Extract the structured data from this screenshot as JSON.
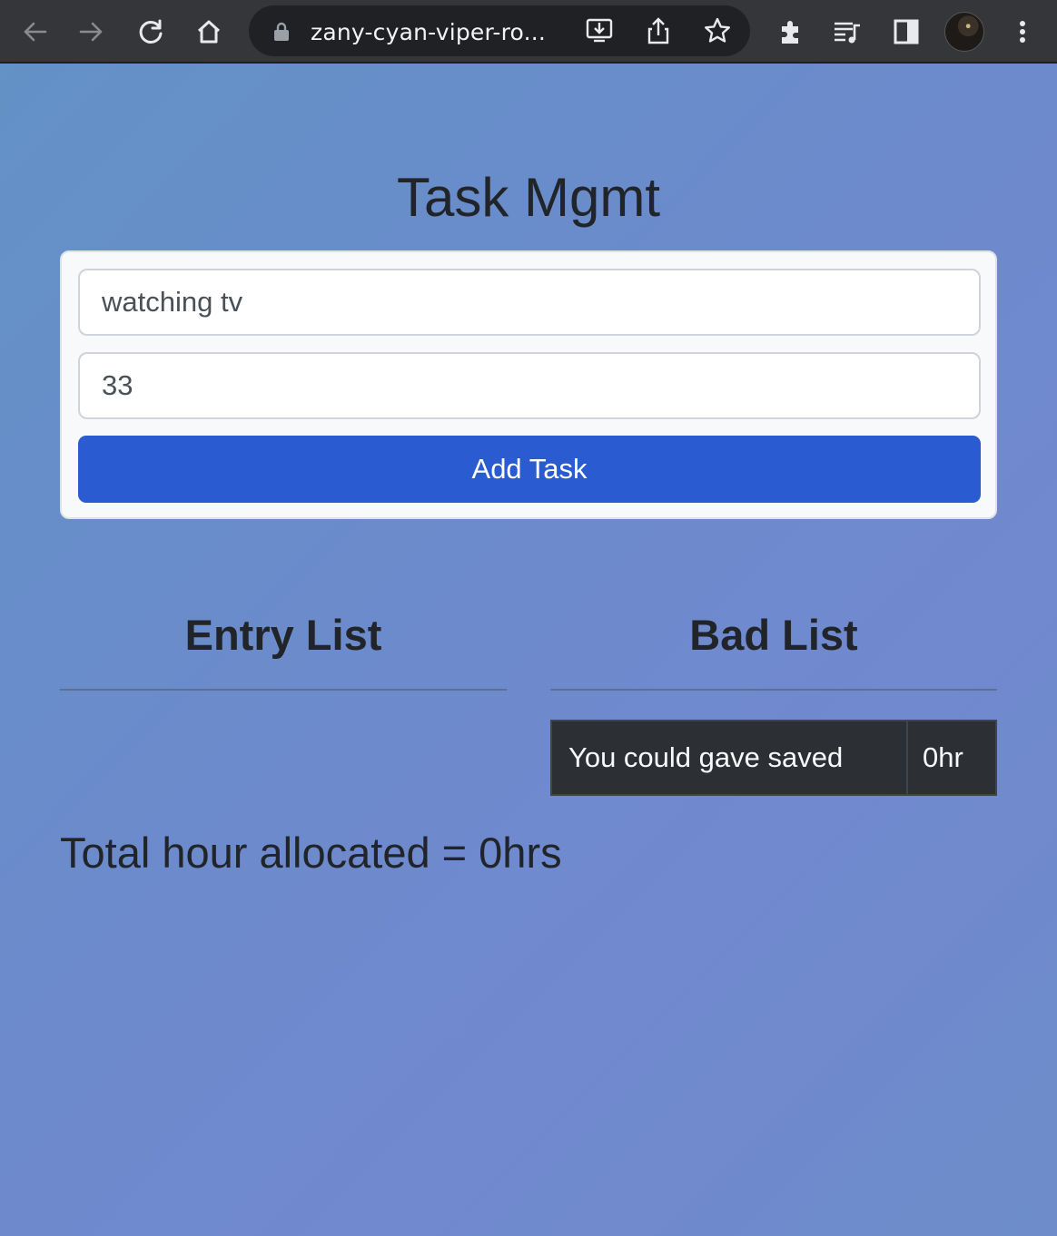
{
  "browser": {
    "url": "zany-cyan-viper-ro...",
    "icons": [
      "back-arrow-icon",
      "forward-arrow-icon",
      "reload-icon",
      "home-icon",
      "lock-icon",
      "install-icon",
      "share-icon",
      "bookmark-star-icon",
      "extensions-icon",
      "media-queue-icon",
      "side-panel-icon",
      "profile-avatar",
      "more-menu-icon"
    ]
  },
  "app": {
    "title": "Task Mgmt"
  },
  "form": {
    "task_value": "watching tv",
    "hours_value": "33",
    "add_label": "Add Task"
  },
  "lists": {
    "entry_title": "Entry List",
    "bad_title": "Bad List",
    "saved_label": "You could gave saved",
    "saved_value": "0hr"
  },
  "summary": {
    "total_text": "Total hour allocated = 0hrs"
  }
}
